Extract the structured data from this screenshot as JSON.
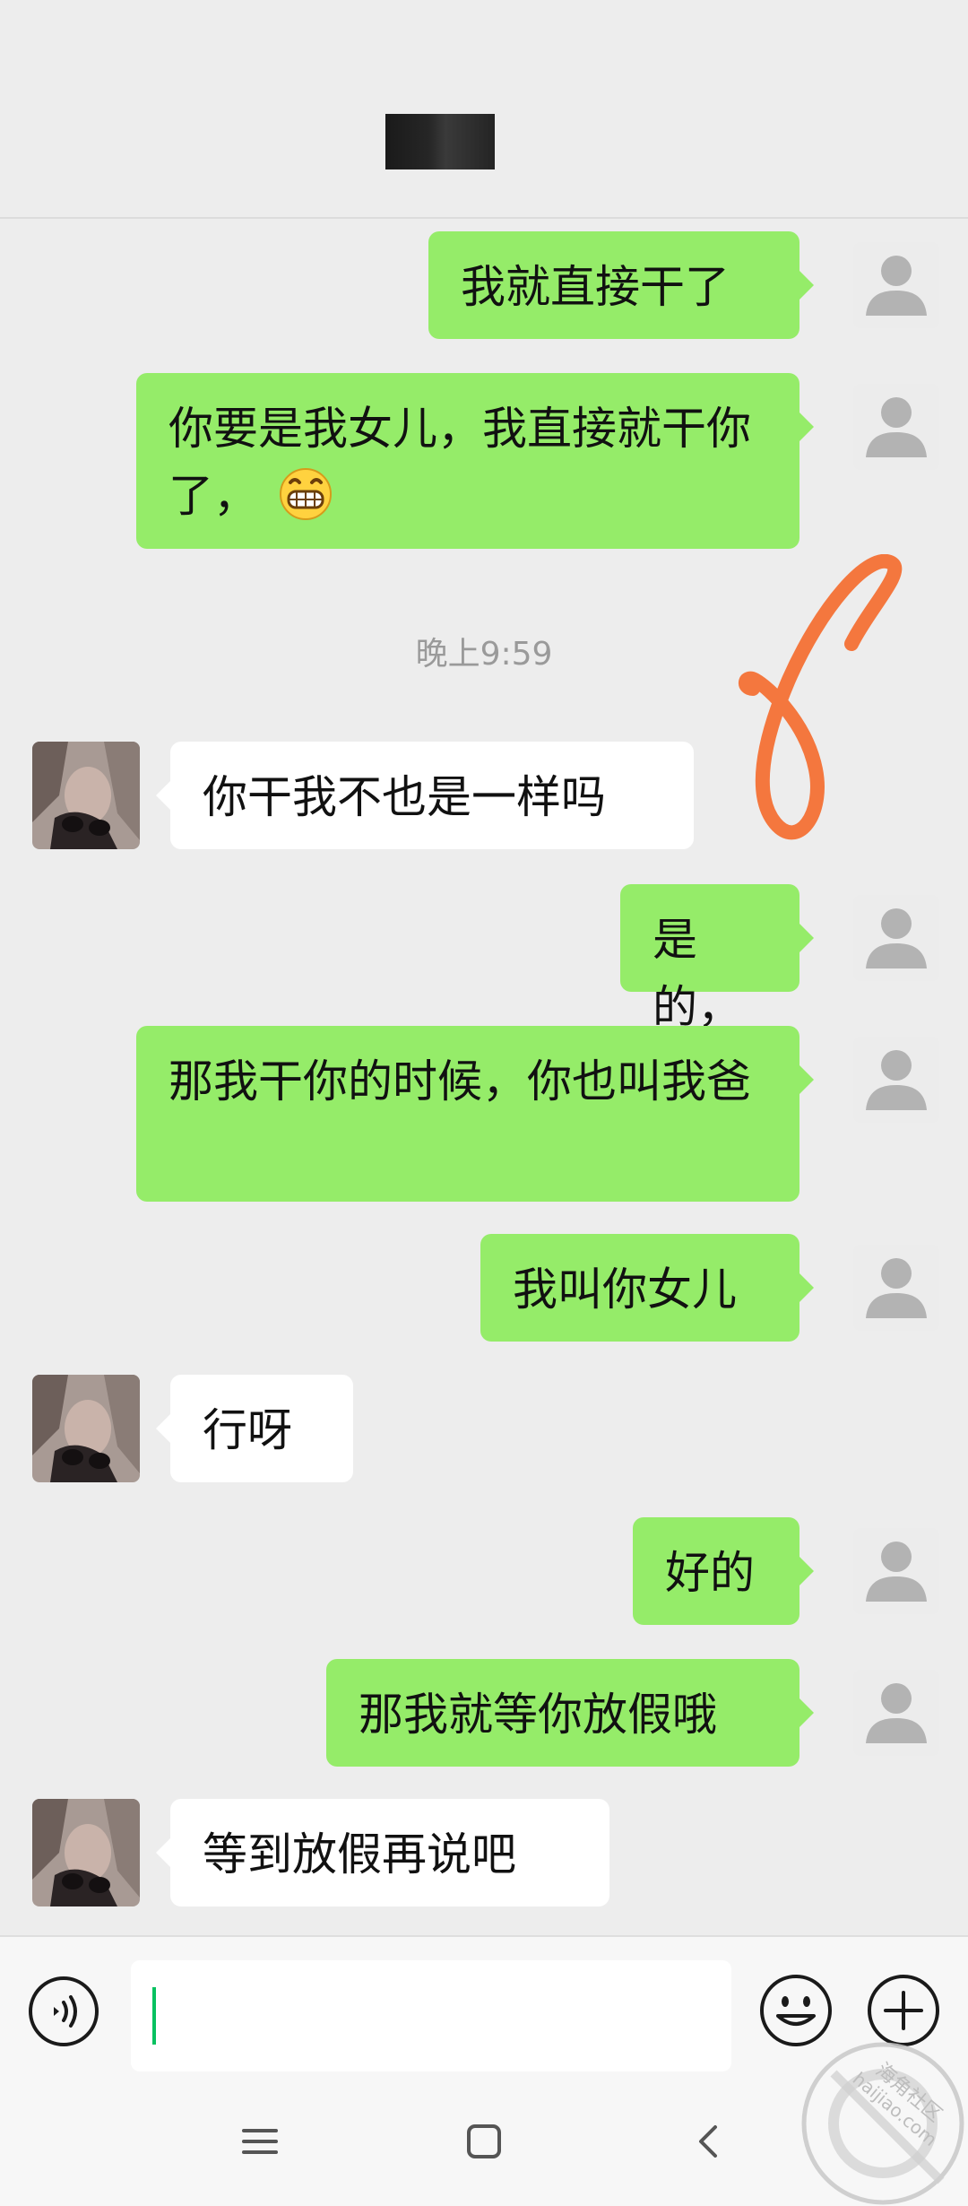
{
  "header": {
    "title_redacted": true
  },
  "messages": [
    {
      "sender": "me",
      "text": "我就直接干了"
    },
    {
      "sender": "me",
      "text": "你要是我女儿，我直接就干你了，",
      "emoji": "grinning-face"
    },
    {
      "sender": "peer",
      "text": "你干我不也是一样吗"
    },
    {
      "sender": "me",
      "text": "是的，"
    },
    {
      "sender": "me",
      "text": "那我干你的时候，你也叫我爸"
    },
    {
      "sender": "me",
      "text": "我叫你女儿"
    },
    {
      "sender": "peer",
      "text": "行呀"
    },
    {
      "sender": "me",
      "text": "好的"
    },
    {
      "sender": "me",
      "text": "那我就等你放假哦"
    },
    {
      "sender": "peer",
      "text": "等到放假再说吧"
    }
  ],
  "timestamp": "晚上9:59",
  "annotation": {
    "scribble": "8",
    "color": "#f4773e"
  },
  "input_bar": {
    "value": "",
    "icons": [
      "voice-icon",
      "emoji-icon",
      "plus-icon"
    ]
  },
  "nav_bar": {
    "icons": [
      "menu-icon",
      "home-icon",
      "back-icon"
    ]
  },
  "watermark": {
    "line1": "海角社区",
    "line2": "haijiao.com"
  },
  "colors": {
    "my_bubble": "#95ec69",
    "peer_bubble": "#ffffff",
    "background": "#ededed",
    "caret": "#07c160"
  }
}
